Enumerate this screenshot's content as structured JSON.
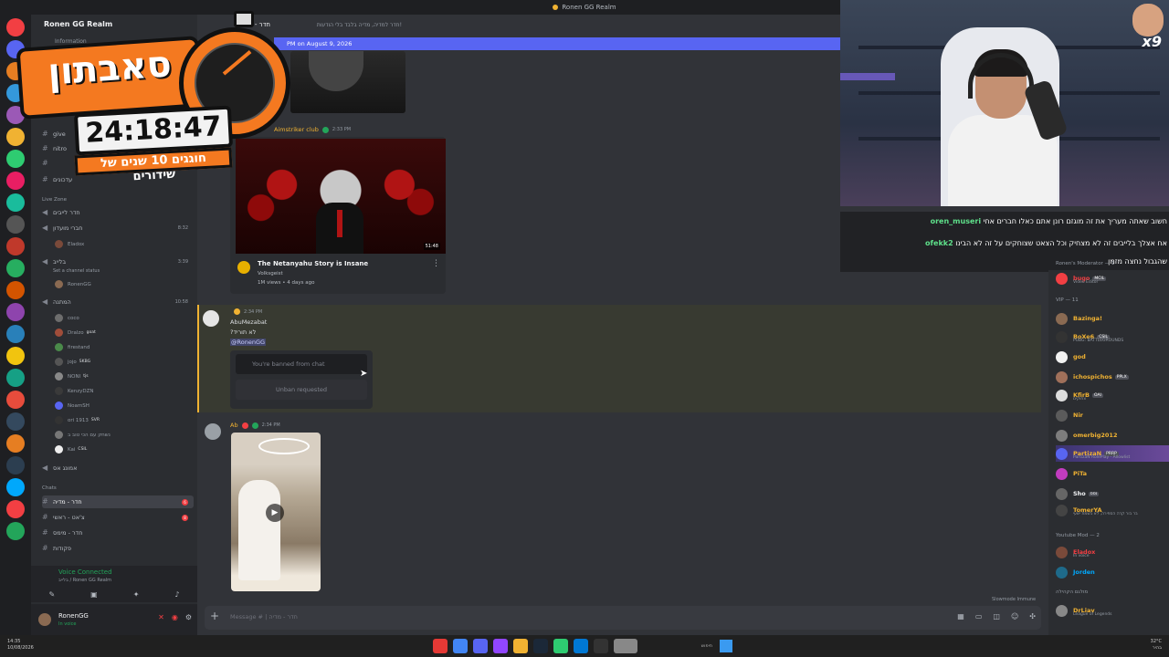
{
  "window": {
    "title": "Ronen GG Realm"
  },
  "server": {
    "name": "Ronen GG Realm",
    "info_label": "Information"
  },
  "promo": {
    "title": "סאבתון",
    "timer": "24:18:47",
    "slogan": "חוגגים 10 שנים של שידורים"
  },
  "sidebar": {
    "channels_top": [
      {
        "label": "give",
        "num": ""
      },
      {
        "label": "nitro",
        "num": ""
      },
      {
        "label": "",
        "num": ""
      },
      {
        "label": "עדכונים",
        "num": ""
      }
    ],
    "category_live": "Live Zone",
    "live_channels": [
      {
        "label": "חדר לייבים",
        "num": ""
      },
      {
        "label": "חברי מועדון",
        "num": "8:32"
      },
      {
        "label": "בלייב",
        "num": "3:39"
      },
      {
        "label": "המתנה",
        "num": "10:58"
      }
    ],
    "eladox": "Eladox",
    "status_hint": "Set a channel status",
    "ronengg": "RonenGG",
    "waiting_members": [
      {
        "name": "coco",
        "tag": ""
      },
      {
        "name": "Dralzo",
        "tag": "goat"
      },
      {
        "name": "firestand",
        "tag": ""
      },
      {
        "name": "jojo",
        "tag": "SKBG"
      },
      {
        "name": "NONI",
        "tag": "tjs"
      },
      {
        "name": "KenzyDZN",
        "tag": ""
      },
      {
        "name": "NoamSH",
        "tag": ""
      },
      {
        "name": "ori 1913",
        "tag": "SVR"
      },
      {
        "name": "נשחק עם הכי טוב ב",
        "tag": ""
      },
      {
        "name": "Kai",
        "tag": "CSIL"
      }
    ],
    "afk": "אמונג אס",
    "category_chats": "Chats",
    "chat_channels": [
      {
        "label": "חדר - מדיה",
        "badge": "6",
        "selected": true
      },
      {
        "label": "צ'אט - ראשי",
        "badge": "8",
        "selected": false
      },
      {
        "label": "חדר - מימס",
        "badge": "",
        "selected": false
      },
      {
        "label": "פקודות",
        "badge": "",
        "selected": false
      }
    ]
  },
  "voice": {
    "status": "Voice Connected",
    "location": "בלייב / Ronen GG Realm"
  },
  "user": {
    "name": "RonenGG",
    "status": "In voice"
  },
  "header": {
    "channel": "חדר - מדיה",
    "topic": "חדר למדיה, מדיה בלבד בלי הודעות!"
  },
  "new_messages": {
    "text": "PM on August 9, 2026"
  },
  "messages": {
    "embed_author": "Aimstriker club",
    "embed_time": "2:33 PM",
    "embed_title": "The Netanyahu Story is Insane",
    "embed_channel": "Volksgeist",
    "embed_meta": "1M views • 4 days ago",
    "embed_duration": "51:48",
    "msg2_time": "2:34 PM",
    "msg2_author": "AbuMezabat",
    "msg2_text": "?לא תוריד",
    "msg2_mention": "@RonenGG",
    "banned_placeholder": "You're banned from chat",
    "unban_button": "Unban requested",
    "msg3_author": "Ab",
    "msg3_time": "2:34 PM"
  },
  "composer": {
    "placeholder": "Message # | חדר - מדיה"
  },
  "slowmode": "Slowmode Immune",
  "cam": {
    "badge": "x9"
  },
  "overlay_chat": [
    {
      "user": "oren_museri",
      "text": "חשוב שאתה מעריך את זה מוגזם רונן אתם כאלו חברים אחי"
    },
    {
      "user": "ofekk2",
      "text": "אח אצלך בלייבים זה לא מצחיק וכל הצאט שצוחקים על זה לא הבינו"
    },
    {
      "user": "",
      "text": "שהגבול נחצה מזמן"
    }
  ],
  "member_list": {
    "mod_cat": "Ronen's Moderator — 1",
    "mods": [
      {
        "name": "bugo",
        "tag": "MCIL",
        "activity": "Video Editor",
        "color": "#f23f43"
      }
    ],
    "vip_cat": "VIP — 11",
    "vips": [
      {
        "name": "Bazinga!",
        "tag": "",
        "activity": "",
        "color": "#f0b232"
      },
      {
        "name": "BoXe6",
        "tag": "CSIL",
        "activity": "PUBG: BATTLEGROUNDS",
        "color": "#f0b232"
      },
      {
        "name": "god",
        "tag": "",
        "activity": "",
        "color": "#f0b232"
      },
      {
        "name": "ichospichos",
        "tag": "PPLX",
        "activity": "",
        "color": "#f0b232"
      },
      {
        "name": "KfirB",
        "tag": "OAI",
        "activity": "צחוקים",
        "color": "#f0b232"
      },
      {
        "name": "Nir",
        "tag": "",
        "activity": "",
        "color": "#f0b232"
      },
      {
        "name": "omerbig2012",
        "tag": "",
        "activity": "",
        "color": "#f0b232"
      },
      {
        "name": "PartizaN",
        "tag": "PRRP",
        "activity": "PartizaN RolePlay - Allowlist",
        "color": "#f0b232"
      },
      {
        "name": "PiTa",
        "tag": "",
        "activity": "",
        "color": "#f0b232"
      },
      {
        "name": "Sho",
        "tag": "נסס",
        "activity": "",
        "color": "#f0b232"
      },
      {
        "name": "TomerYA",
        "tag": "",
        "activity": "בר בור קרה הספירה, לא בשמת ישעי",
        "color": "#f0b232"
      }
    ],
    "ytmod_cat": "Youtube Mod — 2",
    "ytmods": [
      {
        "name": "Eladox",
        "tag": "",
        "activity": "In voice",
        "color": "#f23f43"
      },
      {
        "name": "Jorden",
        "tag": "",
        "activity": "",
        "color": "#00a8fc"
      }
    ],
    "booster_cat": "מולגם הקהילה",
    "boosters": [
      {
        "name": "DrLiav",
        "tag": "",
        "activity": "League of Legends",
        "color": "#f0b232"
      }
    ]
  },
  "taskbar": {
    "time": "14:35",
    "date": "10/08/2026",
    "search": "חיפוש",
    "temp": "32°C",
    "weather": "בהיר"
  }
}
